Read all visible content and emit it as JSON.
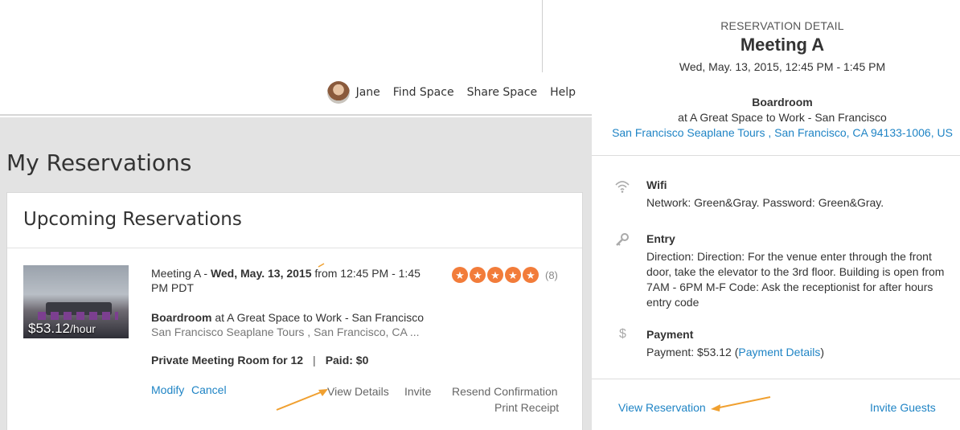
{
  "nav": {
    "user_name": "Jane",
    "find_space": "Find Space",
    "share_space": "Share Space",
    "help": "Help"
  },
  "page": {
    "title": "My Reservations",
    "card_title": "Upcoming Reservations"
  },
  "reservation": {
    "price": "$53.12",
    "price_unit": "/hour",
    "name_prefix": "Meeting A - ",
    "date": "Wed, May. 13, 2015",
    "time_rest": " from 12:45 PM - 1:45 PM PDT",
    "room": "Boardroom",
    "venue_rest": " at A Great Space to Work - San Francisco",
    "address": "San Francisco Seaplane Tours , San Francisco, CA ...",
    "room_type": "Private Meeting Room for 12",
    "separator": "|",
    "paid": "Paid: $0",
    "rating_count": "(8)",
    "rating_value": 5,
    "actions": {
      "modify": "Modify",
      "cancel": "Cancel",
      "view_details": "View Details",
      "invite": "Invite",
      "resend": "Resend Confirmation",
      "print": "Print Receipt"
    }
  },
  "detail": {
    "label": "RESERVATION DETAIL",
    "title": "Meeting A",
    "time": "Wed, May. 13, 2015, 12:45 PM - 1:45 PM",
    "room": "Boardroom",
    "venue": "at A Great Space to Work - San Francisco",
    "address": "San Francisco Seaplane Tours , San Francisco, CA 94133-1006, US",
    "wifi": {
      "heading": "Wifi",
      "text": "Network: Green&Gray. Password: Green&Gray."
    },
    "entry": {
      "heading": "Entry",
      "text": "Direction: Direction: For the venue enter through the front door, take the elevator to the 3rd floor. Building is open from 7AM - 6PM M-F Code: Ask the receptionist for after hours entry code"
    },
    "payment": {
      "heading": "Payment",
      "text_prefix": "Payment: $53.12 (",
      "link": "Payment Details",
      "text_suffix": ")"
    },
    "view_reservation": "View Reservation",
    "invite_guests": "Invite Guests"
  },
  "colors": {
    "link": "#1f84c5",
    "star": "#f27c3a",
    "arrow": "#f0a030"
  }
}
